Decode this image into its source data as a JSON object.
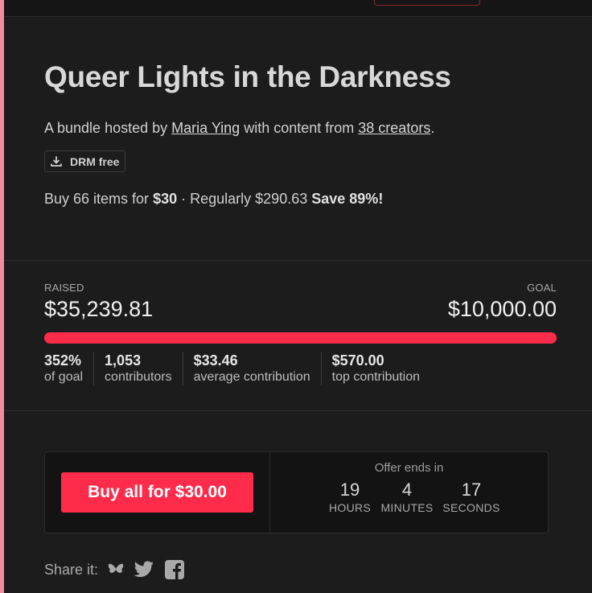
{
  "title": "Queer Lights in the Darkness",
  "byline": {
    "prefix": "A bundle hosted by",
    "host": "Maria Ying",
    "middle": "with content from",
    "creators": "38 creators",
    "suffix": "."
  },
  "drm_badge": {
    "icon": "download-icon",
    "label": "DRM free"
  },
  "price": {
    "prefix": "Buy 66 items for",
    "amount": "$30",
    "middle": " · Regularly $290.63",
    "save": "Save 89%!"
  },
  "stats": {
    "raised_label": "RAISED",
    "raised_value": "$35,239.81",
    "goal_label": "GOAL",
    "goal_value": "$10,000.00",
    "progress_fraction": 1.0,
    "metrics": [
      {
        "value": "352%",
        "label": "of goal"
      },
      {
        "value": "1,053",
        "label": "contributors"
      },
      {
        "value": "$33.46",
        "label": "average contribution"
      },
      {
        "value": "$570.00",
        "label": "top contribution"
      }
    ]
  },
  "purchase": {
    "button_label": "Buy all for $30.00",
    "offer_label": "Offer ends in",
    "countdown": [
      {
        "value": "19",
        "unit": "HOURS"
      },
      {
        "value": "4",
        "unit": "MINUTES"
      },
      {
        "value": "17",
        "unit": "SECONDS"
      }
    ]
  },
  "share": {
    "label": "Share it:",
    "icons": [
      "butterfly-icon",
      "twitter-icon",
      "facebook-icon"
    ]
  },
  "colors": {
    "accent": "#ff2b4b",
    "background": "#1c1c1c",
    "left_stripe": "#f28ba0"
  }
}
